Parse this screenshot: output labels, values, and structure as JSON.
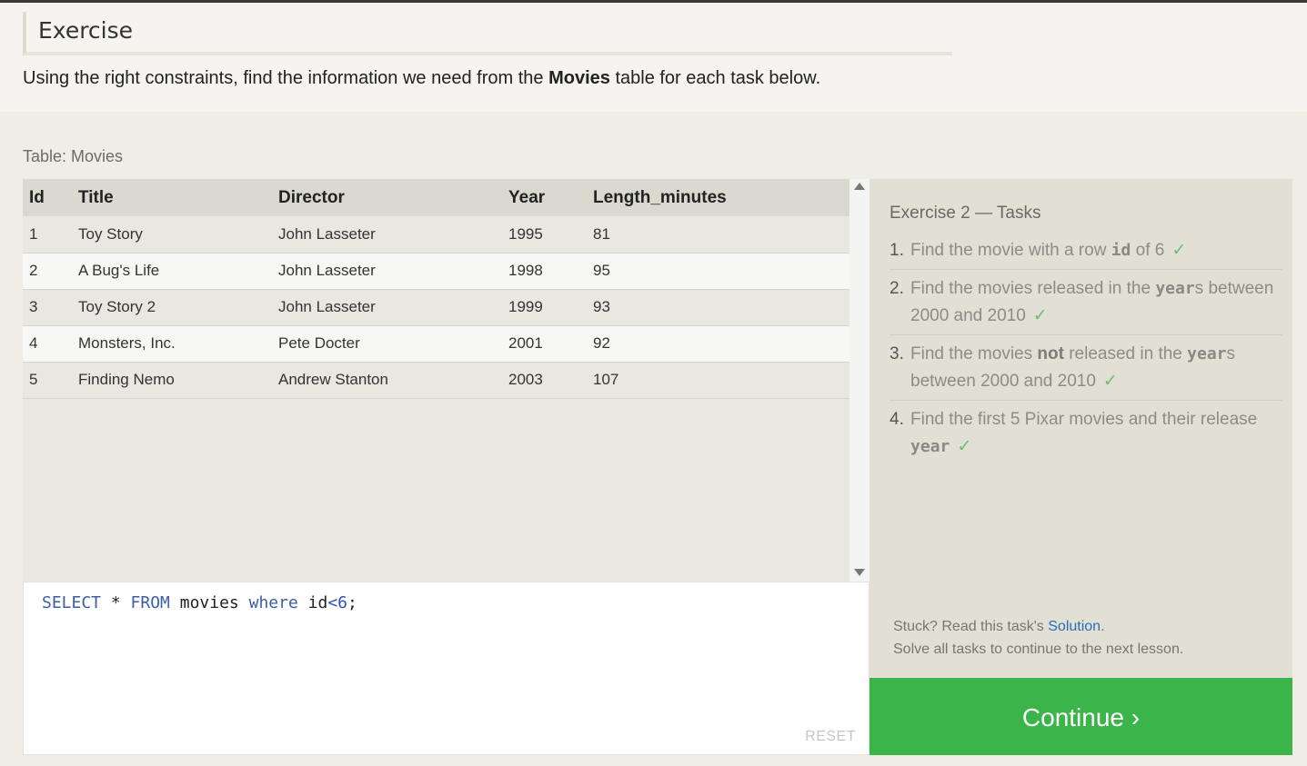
{
  "header": {
    "title": "Exercise",
    "instruction_before": "Using the right constraints, find the information we need from the ",
    "instruction_bold": "Movies",
    "instruction_after": " table for each task below."
  },
  "table": {
    "caption": "Table: Movies",
    "columns": [
      "Id",
      "Title",
      "Director",
      "Year",
      "Length_minutes"
    ],
    "rows": [
      [
        "1",
        "Toy Story",
        "John Lasseter",
        "1995",
        "81"
      ],
      [
        "2",
        "A Bug's Life",
        "John Lasseter",
        "1998",
        "95"
      ],
      [
        "3",
        "Toy Story 2",
        "John Lasseter",
        "1999",
        "93"
      ],
      [
        "4",
        "Monsters, Inc.",
        "Pete Docter",
        "2001",
        "92"
      ],
      [
        "5",
        "Finding Nemo",
        "Andrew Stanton",
        "2003",
        "107"
      ]
    ]
  },
  "editor": {
    "code": {
      "t1": "SELECT",
      "t2": " * ",
      "t3": "FROM",
      "t4": " movies ",
      "t5": "where",
      "t6": " id",
      "t7": "<",
      "t8": "6",
      "t9": ";"
    },
    "reset_label": "RESET"
  },
  "tasks": {
    "title": "Exercise 2 — Tasks",
    "items": [
      {
        "num": "1.",
        "a": "Find the movie with a row ",
        "code": "id",
        "b": " of 6",
        "check": "✓"
      },
      {
        "num": "2.",
        "a": "Find the movies released in the ",
        "code": "year",
        "b": "s between 2000 and 2010",
        "check": "✓"
      },
      {
        "num": "3.",
        "a": "Find the movies ",
        "bold": "not",
        "a2": " released in the ",
        "code": "year",
        "b": "s between 2000 and 2010",
        "check": "✓"
      },
      {
        "num": "4.",
        "a": "Find the first 5 Pixar movies and their release ",
        "code": "year",
        "b": "",
        "check": "✓"
      }
    ],
    "help_prefix": "Stuck? Read this task's ",
    "help_link": "Solution",
    "help_suffix": ".",
    "help_line2": "Solve all tasks to continue to the next lesson."
  },
  "continue_label": "Continue ›",
  "colors": {
    "accent": "#3bb54a",
    "link": "#2a6ebb",
    "keyword": "#3a5fa8"
  }
}
